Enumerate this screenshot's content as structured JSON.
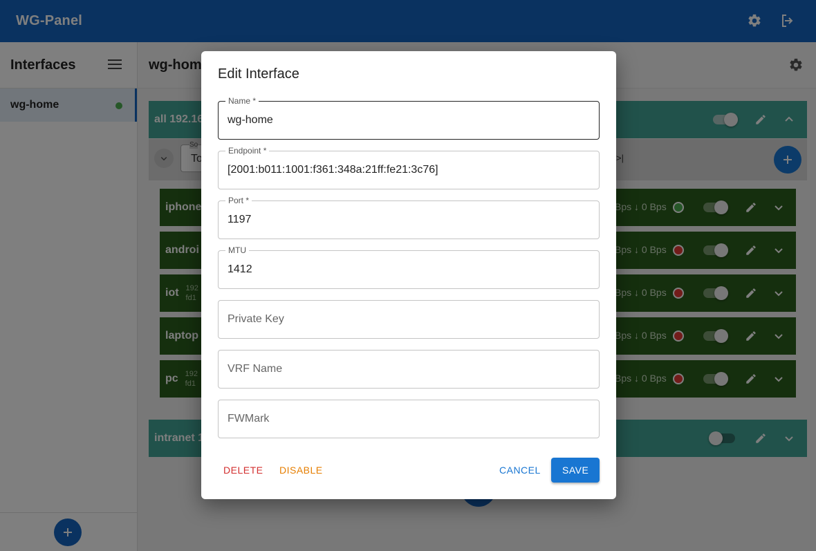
{
  "app": {
    "title": "WG-Panel"
  },
  "sidebar": {
    "heading": "Interfaces",
    "items": [
      {
        "label": "wg-home"
      }
    ]
  },
  "main": {
    "heading": "wg-home",
    "groups": [
      {
        "label": "all 192.16"
      },
      {
        "label": "intranet 1"
      }
    ],
    "sort_label": "So",
    "sort_value": "To",
    "peers": [
      {
        "name": "iphone",
        "sub1": "",
        "sub2": "",
        "stats": "Bps ↓ 0 Bps",
        "status": "#4caf50"
      },
      {
        "name": "androi",
        "sub1": "",
        "sub2": "",
        "stats": "Bps ↓ 0 Bps",
        "status": "#e53935"
      },
      {
        "name": "iot",
        "sub1": "192",
        "sub2": "fd1",
        "stats": "Bps ↓ 0 Bps",
        "status": "#e53935"
      },
      {
        "name": "laptop",
        "sub1": "",
        "sub2": "",
        "stats": "Bps ↓ 0 Bps",
        "status": "#e53935"
      },
      {
        "name": "pc",
        "sub1": "192",
        "sub2": "fd1",
        "stats": "Bps ↓ 0 Bps",
        "status": "#e53935"
      }
    ]
  },
  "dialog": {
    "title": "Edit Interface",
    "fields": {
      "name": {
        "label": "Name *",
        "value": "wg-home"
      },
      "endpoint": {
        "label": "Endpoint *",
        "value": "[2001:b011:1001:f361:348a:21ff:fe21:3c76]"
      },
      "port": {
        "label": "Port *",
        "value": "1197"
      },
      "mtu": {
        "label": "MTU",
        "value": "1412"
      },
      "private_key": {
        "placeholder": "Private Key"
      },
      "vrf_name": {
        "placeholder": "VRF Name"
      },
      "fwmark": {
        "placeholder": "FWMark"
      }
    },
    "buttons": {
      "delete": "DELETE",
      "disable": "DISABLE",
      "cancel": "CANCEL",
      "save": "SAVE"
    }
  },
  "colors": {
    "primary": "#1565c0",
    "group": "#43a596",
    "peer": "#2b5e1d",
    "delete": "#d32f2f",
    "disable": "#e67e00",
    "online": "#4caf50",
    "offline": "#e53935"
  }
}
